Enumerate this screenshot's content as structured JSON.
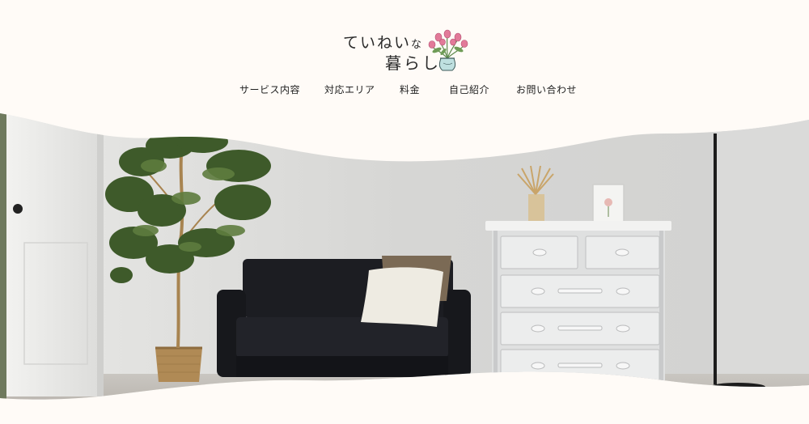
{
  "header": {
    "logo_line1": "ていねい",
    "logo_line1_small": "な",
    "logo_line2": "暮らし",
    "logo_icon": "tulip-vase-icon"
  },
  "nav": {
    "items": [
      {
        "label": "サービス内容"
      },
      {
        "label": "対応エリア"
      },
      {
        "label": "料金"
      },
      {
        "label": "自己紹介"
      },
      {
        "label": "お問い合わせ"
      }
    ]
  },
  "hero": {
    "image": "living-room-photo",
    "objects": [
      "door",
      "potted-ficus-tree",
      "black-sofa",
      "cream-cushion",
      "brown-cushion",
      "white-chest-of-drawers",
      "dried-wheat-vase",
      "framed-flower-picture",
      "floor-lamp"
    ]
  },
  "colors": {
    "background": "#fffbf7",
    "text": "#222222",
    "wall": "#d8d8d6",
    "sofa": "#1c1d22",
    "chest": "#e9eaea",
    "leaf": "#3e5a2a"
  }
}
